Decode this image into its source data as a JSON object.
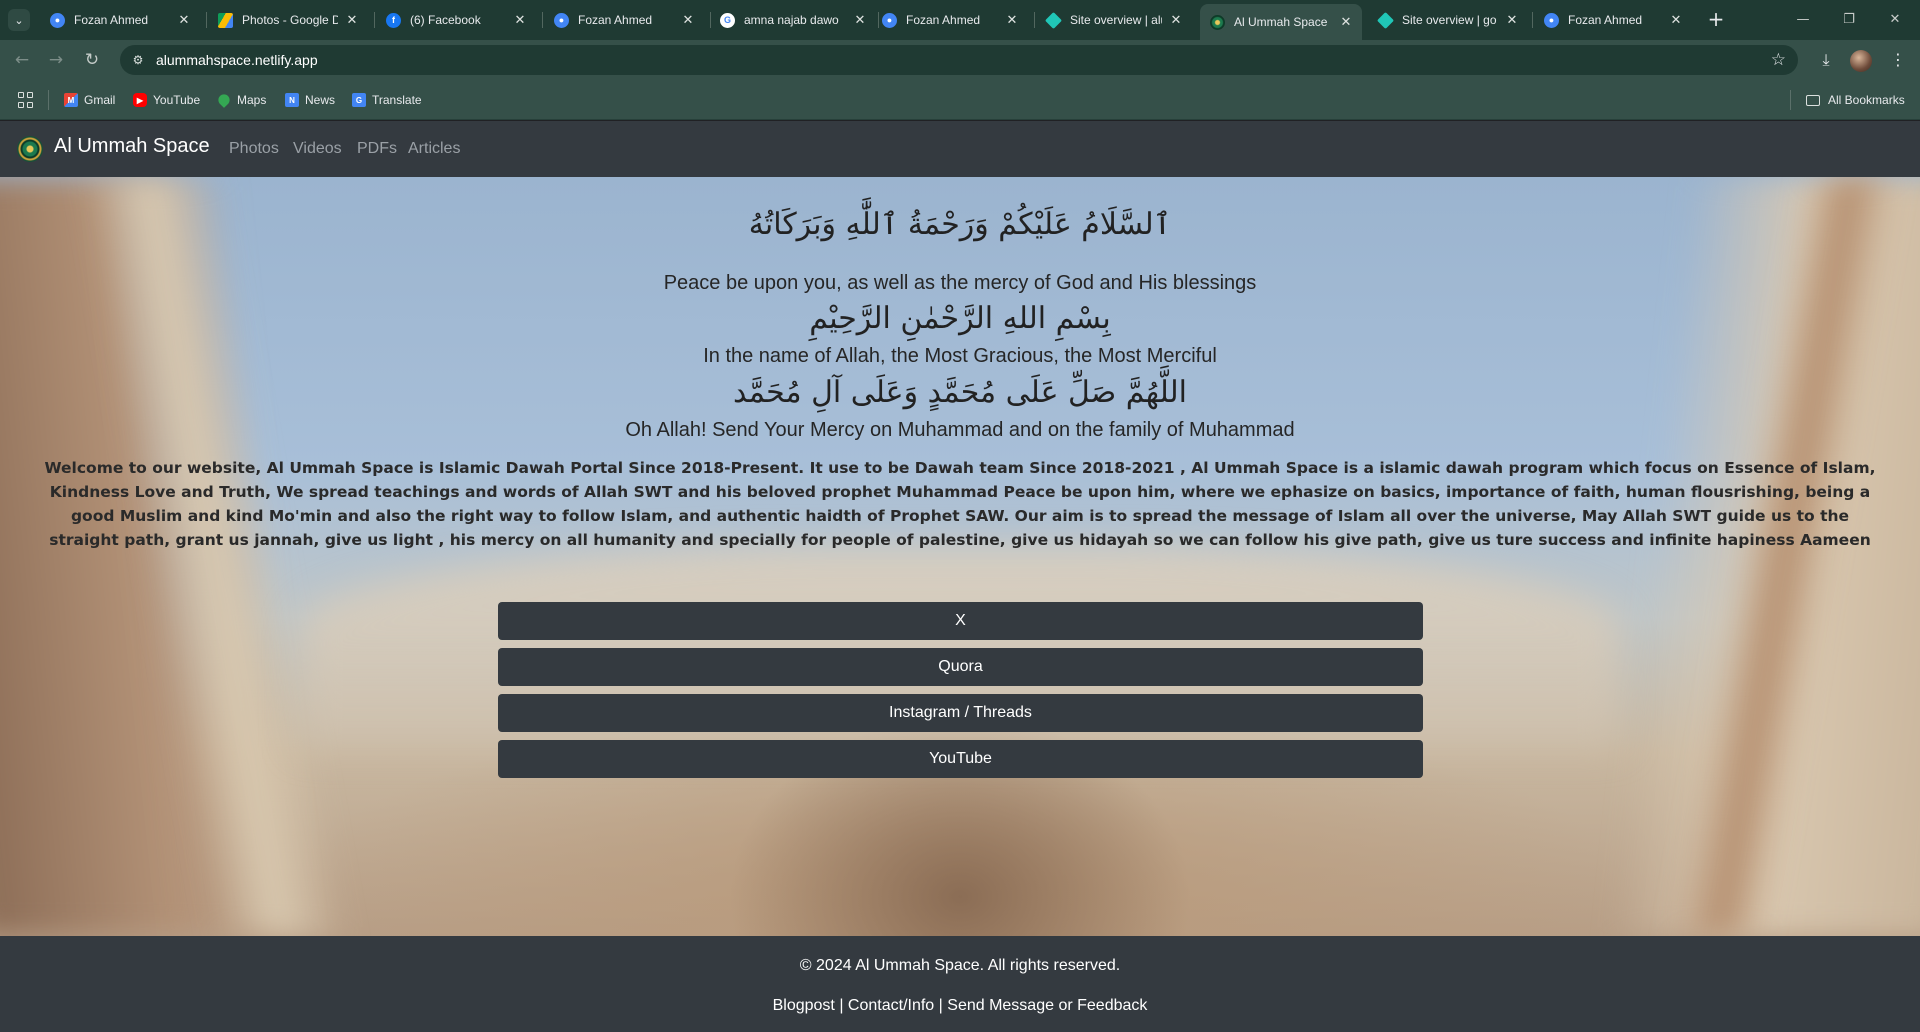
{
  "browser": {
    "tabs": [
      {
        "label": "Fozan Ahmed",
        "icon": "profile-icon",
        "color": "#4285f4"
      },
      {
        "label": "Photos - Google Drive",
        "icon": "google-drive-icon",
        "color": "#fbbc04"
      },
      {
        "label": "(6) Facebook",
        "icon": "facebook-icon",
        "color": "#1877f2"
      },
      {
        "label": "Fozan Ahmed",
        "icon": "profile-icon",
        "color": "#4285f4"
      },
      {
        "label": "amna najab dawo",
        "icon": "google-icon",
        "color": "#ffffff"
      },
      {
        "label": "Fozan Ahmed",
        "icon": "profile-icon",
        "color": "#4285f4"
      },
      {
        "label": "Site overview | alu",
        "icon": "netlify-icon",
        "color": "#20c6b7"
      },
      {
        "label": "Al Ummah Space",
        "icon": "site-logo-icon",
        "color": "#1d7a4e"
      },
      {
        "label": "Site overview | go",
        "icon": "netlify-icon",
        "color": "#20c6b7"
      },
      {
        "label": "Fozan Ahmed",
        "icon": "profile-icon",
        "color": "#4285f4"
      }
    ],
    "url": "alummahspace.netlify.app",
    "bookmarks": [
      {
        "label": "Gmail",
        "icon": "gmail-icon"
      },
      {
        "label": "YouTube",
        "icon": "youtube-icon"
      },
      {
        "label": "Maps",
        "icon": "maps-icon"
      },
      {
        "label": "News",
        "icon": "news-icon"
      },
      {
        "label": "Translate",
        "icon": "translate-icon"
      }
    ],
    "all_bookmarks_label": "All Bookmarks"
  },
  "site": {
    "brand": "Al Ummah Space",
    "nav": [
      "Photos",
      "Videos",
      "PDFs",
      "Articles"
    ],
    "greeting_ar": "ٱلسَّلَامُ عَلَيْكُمْ وَرَحْمَةُ ٱللَّٰهِ وَبَرَكَاتُهُ",
    "greeting_en": "Peace be upon you, as well as the mercy of God and His blessings",
    "bismillah_ar": "بِسْمِ اللهِ الرَّحْمٰنِ الرَّحِيْمِ",
    "bismillah_en": "In the name of Allah, the Most Gracious, the Most Merciful",
    "durood_ar": "اللَّهُمَّ صَلِّ عَلَى مُحَمَّدٍ وَعَلَى آلِ مُحَمَّد",
    "durood_en": "Oh Allah! Send Your Mercy on Muhammad and on the family of Muhammad",
    "welcome": "Welcome to our website, Al Ummah Space is Islamic Dawah Portal Since 2018-Present. It use to be Dawah team Since 2018-2021 , Al Ummah Space is a islamic dawah program which focus on Essence of Islam, Kindness Love and Truth, We spread teachings and words of Allah SWT and his beloved prophet Muhammad Peace be upon him, where we ephasize on basics, importance of faith, human flousrishing, being a good Muslim and kind Mo'min and also the right way to follow Islam, and authentic haidth of Prophet SAW. Our aim is to spread the message of Islam all over the universe, May Allah SWT guide us to the straight path, grant us jannah, give us light , his mercy on all humanity and specially for people of palestine, give us hidayah so we can follow his give path, give us ture success and infinite hapiness Aameen",
    "buttons": [
      "X",
      "Quora",
      "Instagram / Threads",
      "YouTube"
    ],
    "footer": {
      "copyright": "© 2024 Al Ummah Space. All rights reserved.",
      "links": [
        "Blogpost",
        "Contact/Info",
        "Send Message or Feedback"
      ],
      "separator": "|"
    }
  }
}
